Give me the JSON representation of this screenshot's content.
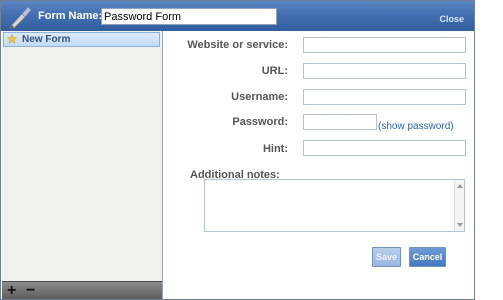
{
  "window": {
    "form_name_label": "Form Name:",
    "form_name_value": "Password Form",
    "close_label": "Close"
  },
  "sidebar": {
    "items": [
      {
        "label": "New Form"
      }
    ],
    "add_label": "+",
    "remove_label": "−"
  },
  "form": {
    "fields": [
      {
        "label": "Website or service:",
        "value": ""
      },
      {
        "label": "URL:",
        "value": ""
      },
      {
        "label": "Username:",
        "value": ""
      },
      {
        "label": "Password:",
        "value": ""
      },
      {
        "label": "Hint:",
        "value": ""
      }
    ],
    "show_password_label": "(show password)",
    "notes_label": "Additional notes:",
    "save_label": "Save",
    "cancel_label": "Cancel"
  },
  "colors": {
    "titlebar": "#3f6db0",
    "link": "#2d63b5",
    "sidebar_bg": "#f1f1eb",
    "selected_item": "#c3dbf5"
  },
  "icons": [
    "brush-icon",
    "star-icon",
    "add-icon",
    "remove-icon",
    "scroll-up-icon",
    "scroll-down-icon"
  ]
}
